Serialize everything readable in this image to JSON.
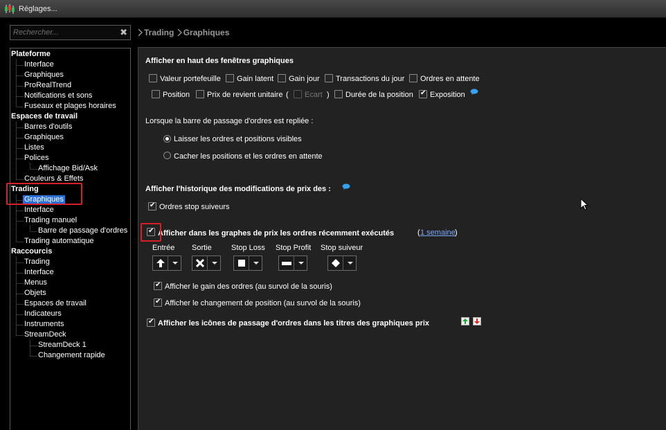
{
  "window": {
    "title": "Réglages...",
    "app_icon": "candlestick-icon"
  },
  "search": {
    "placeholder": "Rechercher...",
    "value": "",
    "clear_icon": "close-icon"
  },
  "breadcrumb": [
    "Trading",
    "Graphiques"
  ],
  "sidebar": {
    "selected": "Trading > Graphiques",
    "groups": [
      {
        "label": "Plateforme",
        "items": [
          "Interface",
          "Graphiques",
          "ProRealTrend",
          "Notifications et sons",
          "Fuseaux et plages horaires"
        ]
      },
      {
        "label": "Espaces de travail",
        "items": [
          "Barres d'outils",
          "Graphiques",
          "Listes",
          "Polices",
          "Affichage Bid/Ask",
          "Couleurs & Effets"
        ]
      },
      {
        "label": "Trading",
        "items": [
          "Graphiques",
          "Interface",
          "Trading manuel",
          "Barre de passage d'ordres",
          "Trading automatique"
        ]
      },
      {
        "label": "Raccourcis",
        "items": [
          "Trading",
          "Interface",
          "Menus",
          "Objets",
          "Espaces de travail",
          "Indicateurs",
          "Instruments",
          "StreamDeck",
          "StreamDeck 1",
          "Changement rapide"
        ]
      }
    ]
  },
  "main": {
    "section1": {
      "title": "Afficher en haut des fenêtres graphiques",
      "row1": [
        {
          "label": "Valeur portefeuille",
          "checked": false
        },
        {
          "label": "Gain latent",
          "checked": false
        },
        {
          "label": "Gain jour",
          "checked": false
        },
        {
          "label": "Transactions du jour",
          "checked": false
        },
        {
          "label": "Ordres en attente",
          "checked": false
        }
      ],
      "row2": [
        {
          "label": "Position",
          "checked": false
        },
        {
          "label": "Prix de revient unitaire",
          "checked": false
        },
        {
          "label": "Ecart",
          "checked": false,
          "disabled": true
        },
        {
          "label": "Durée de la position",
          "checked": false
        },
        {
          "label": "Exposition",
          "checked": true
        }
      ],
      "paren_open": "(",
      "paren_close": ")"
    },
    "section2": {
      "title": "Lorsque la barre de passage d'ordres est repliée :",
      "options": [
        {
          "label": "Laisser les ordres et positions visibles",
          "selected": true
        },
        {
          "label": "Cacher les positions et les ordres en attente",
          "selected": false
        }
      ]
    },
    "section3": {
      "title": "Afficher l'historique des modifications de prix des :",
      "option": {
        "label": "Ordres stop suiveurs",
        "checked": true
      }
    },
    "section4": {
      "title": "Afficher dans les graphes de prix les ordres récemment exécutés",
      "checked": true,
      "period_open": "(",
      "period": "1 semaine",
      "period_close": ")",
      "markers": [
        {
          "label": "Entrée",
          "symbol": "arrow-up-icon"
        },
        {
          "label": "Sortie",
          "symbol": "cross-icon"
        },
        {
          "label": "Stop Loss",
          "symbol": "square-icon"
        },
        {
          "label": "Stop Profit",
          "symbol": "dash-icon"
        },
        {
          "label": "Stop suiveur",
          "symbol": "diamond-icon"
        }
      ],
      "sub_options": [
        {
          "label": "Afficher le gain des ordres (au survol de la souris)",
          "checked": true
        },
        {
          "label": "Afficher le changement de position (au survol de la souris)",
          "checked": true
        }
      ]
    },
    "section5": {
      "label": "Afficher les icônes de passage d'ordres dans les titres des graphiques prix",
      "checked": true
    }
  },
  "colors": {
    "accent_selection": "#2b6fd8",
    "highlight_box": "#d61f26",
    "panel_bg": "#222222",
    "link": "#7aa8ff"
  }
}
